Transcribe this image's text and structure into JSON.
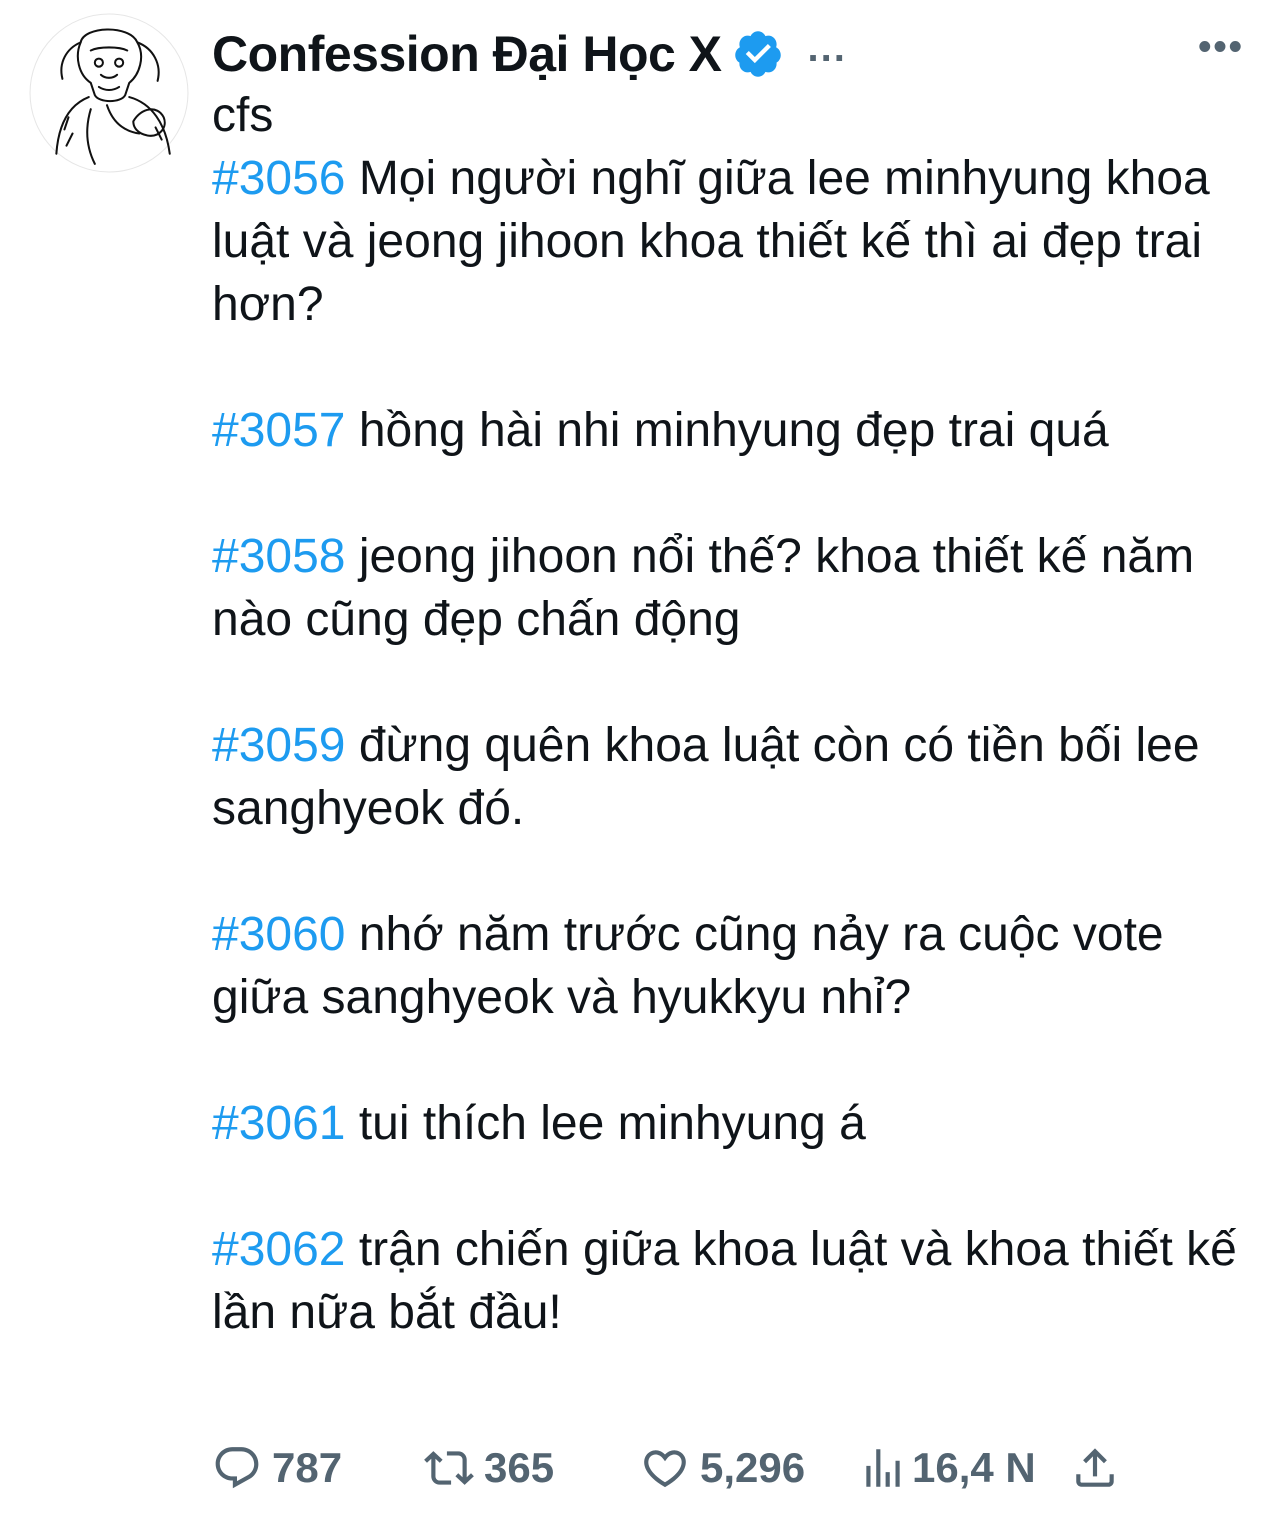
{
  "author": {
    "display_name": "Confession Đại Học X",
    "verified_icon": "verified-badge-icon",
    "header_more": "...",
    "avatar_icon": "orangutan-drawing-avatar"
  },
  "top_more": "•••",
  "tweet": {
    "intro": "cfs",
    "confessions": [
      {
        "tag": "#3056",
        "text": " Mọi người nghĩ giữa lee minhyung khoa luật và jeong jihoon khoa thiết kế thì ai đẹp trai hơn?"
      },
      {
        "tag": "#3057",
        "text": " hồng hài nhi minhyung đẹp trai quá"
      },
      {
        "tag": "#3058",
        "text": " jeong jihoon nổi thế? khoa thiết kế năm nào cũng đẹp chấn động"
      },
      {
        "tag": "#3059",
        "text": " đừng quên khoa luật còn có tiền bối lee sanghyeok đó."
      },
      {
        "tag": "#3060",
        "text": " nhớ năm trước cũng nảy ra cuộc vote giữa sanghyeok và hyukkyu nhỉ?"
      },
      {
        "tag": "#3061",
        "text": " tui thích lee minhyung á"
      },
      {
        "tag": "#3062",
        "text": " trận chiến giữa khoa luật và khoa thiết kế lần nữa bắt đầu!"
      }
    ]
  },
  "actions": {
    "replies": "787",
    "retweets": "365",
    "likes": "5,296",
    "views": "16,4 N"
  },
  "colors": {
    "hashtag": "#1d9bf0",
    "verified": "#1d9bf0",
    "text": "#0f1419",
    "muted": "#536471"
  }
}
